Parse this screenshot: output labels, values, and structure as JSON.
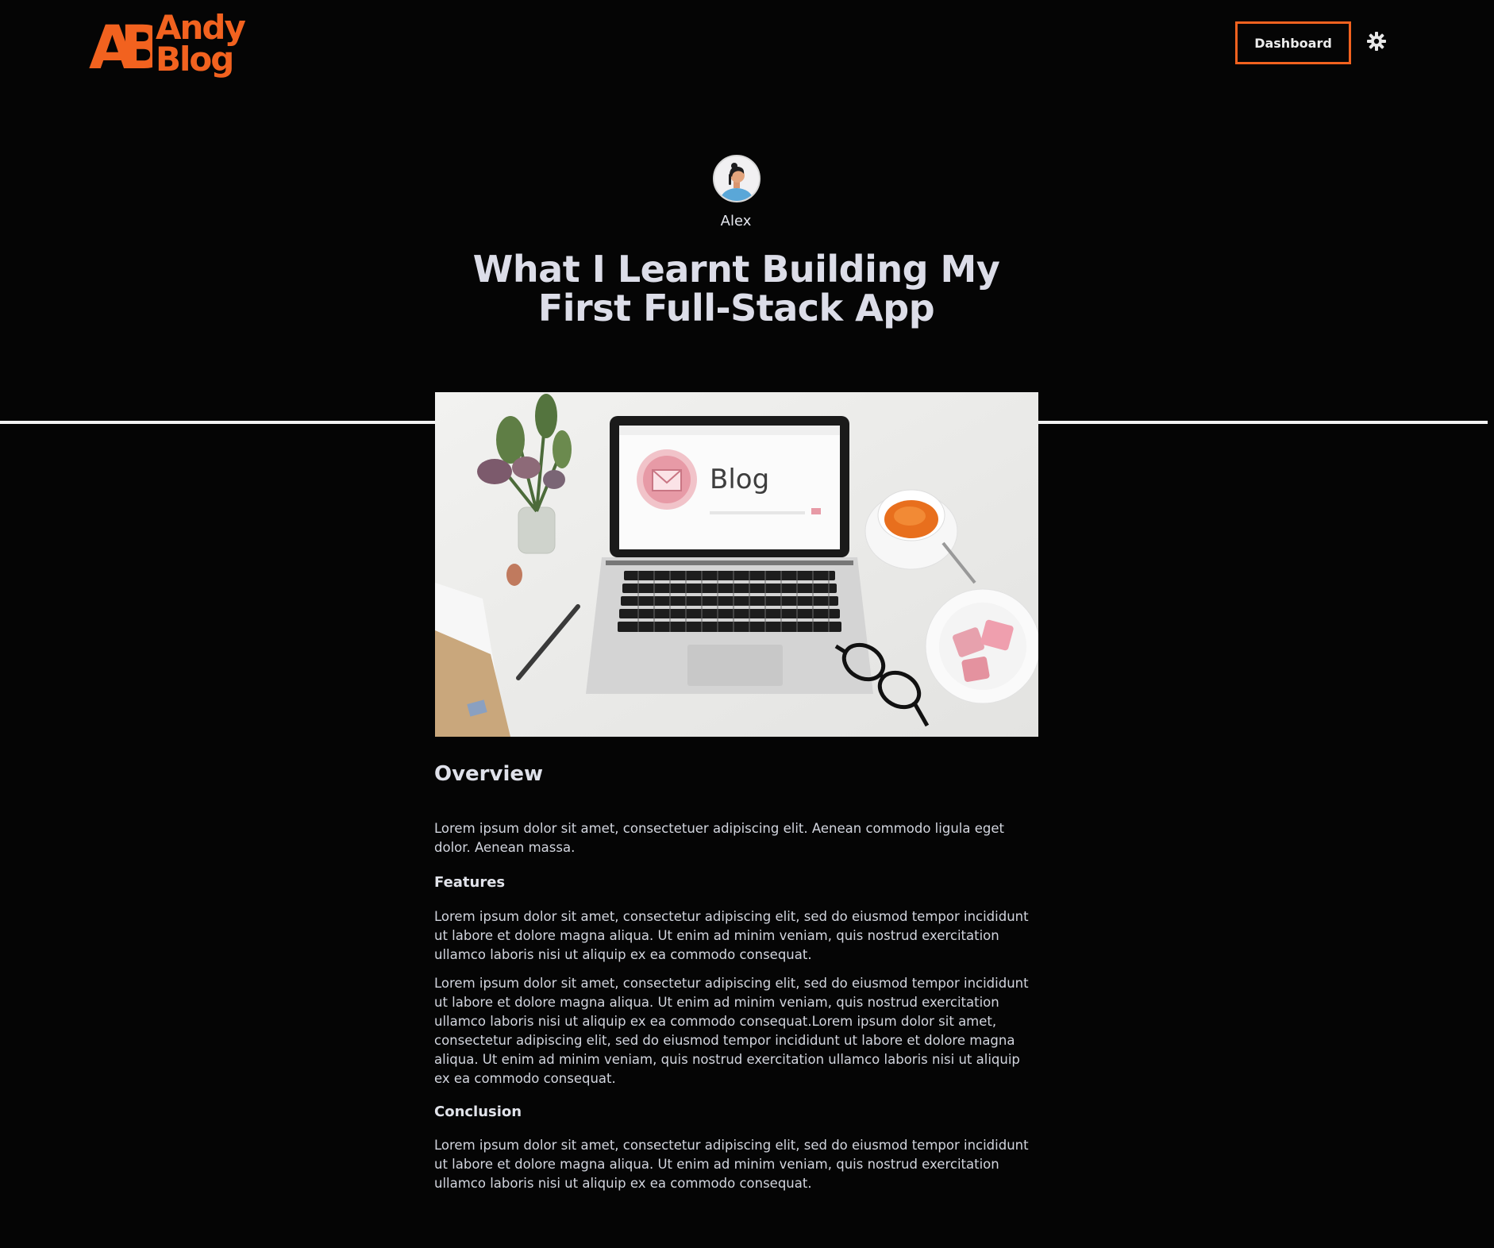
{
  "header": {
    "logo": {
      "monogram": "AB",
      "line1": "Andy",
      "line2": "Blog"
    },
    "dashboard_label": "Dashboard",
    "theme_icon": "sun-gear-icon"
  },
  "author": {
    "name": "Alex"
  },
  "post": {
    "title": "What I Learnt Building My First Full-Stack App",
    "hero_image_text": "Blog",
    "sections": {
      "overview_heading": "Overview",
      "overview_text": "Lorem ipsum dolor sit amet, consectetuer adipiscing elit. Aenean commodo ligula eget dolor. Aenean massa.",
      "features_heading": "Features",
      "features_text_1": "Lorem ipsum dolor sit amet, consectetur adipiscing elit, sed do eiusmod tempor incididunt ut labore et dolore magna aliqua. Ut enim ad minim veniam, quis nostrud exercitation ullamco laboris nisi ut aliquip ex ea commodo consequat.",
      "features_text_2": "Lorem ipsum dolor sit amet, consectetur adipiscing elit, sed do eiusmod tempor incididunt ut labore et dolore magna aliqua. Ut enim ad minim veniam, quis nostrud exercitation ullamco laboris nisi ut aliquip ex ea commodo consequat.Lorem ipsum dolor sit amet, consectetur adipiscing elit, sed do eiusmod tempor incididunt ut labore et dolore magna aliqua. Ut enim ad minim veniam, quis nostrud exercitation ullamco laboris nisi ut aliquip ex ea commodo consequat.",
      "conclusion_heading": "Conclusion",
      "conclusion_text": "Lorem ipsum dolor sit amet, consectetur adipiscing elit, sed do eiusmod tempor incididunt ut labore et dolore magna aliqua. Ut enim ad minim veniam, quis nostrud exercitation ullamco laboris nisi ut aliquip ex ea commodo consequat."
    }
  },
  "colors": {
    "background": "#050505",
    "accent": "#f2621f",
    "text": "#d9dbe3"
  }
}
